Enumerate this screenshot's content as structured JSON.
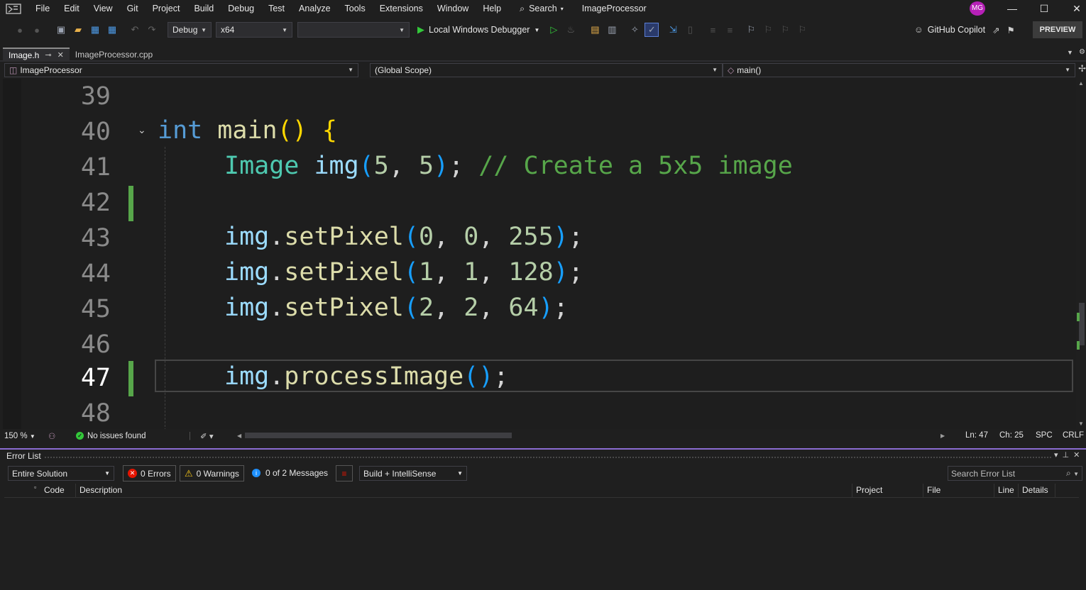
{
  "menu": {
    "items": [
      "File",
      "Edit",
      "View",
      "Git",
      "Project",
      "Build",
      "Debug",
      "Test",
      "Analyze",
      "Tools",
      "Extensions",
      "Window",
      "Help"
    ],
    "search_label": "Search",
    "solution_name": "ImageProcessor",
    "avatar_initials": "MG"
  },
  "toolbar": {
    "configuration": "Debug",
    "platform": "x64",
    "startup_item": "",
    "run_label": "Local Windows Debugger",
    "copilot_label": "GitHub Copilot",
    "preview_label": "PREVIEW"
  },
  "tabs": [
    {
      "label": "Image.h",
      "active": true
    },
    {
      "label": "ImageProcessor.cpp",
      "active": false
    }
  ],
  "navbar": {
    "project": "ImageProcessor",
    "scope": "(Global Scope)",
    "member": "main()"
  },
  "editor": {
    "lines": [
      {
        "number": "39"
      },
      {
        "number": "40"
      },
      {
        "number": "41"
      },
      {
        "number": "42"
      },
      {
        "number": "43"
      },
      {
        "number": "44"
      },
      {
        "number": "45"
      },
      {
        "number": "46"
      },
      {
        "number": "47"
      },
      {
        "number": "48"
      }
    ],
    "code": {
      "l40_kw": "int",
      "l40_fn": "main",
      "l41_type": "Image",
      "l41_var": "img",
      "l41_a1": "5",
      "l41_a2": "5",
      "l41_comment": "// Create a 5x5 image",
      "l43_var": "img",
      "l43_fn": "setPixel",
      "l43_args": [
        "0",
        "0",
        "255"
      ],
      "l44_var": "img",
      "l44_fn": "setPixel",
      "l44_args": [
        "1",
        "1",
        "128"
      ],
      "l45_var": "img",
      "l45_fn": "setPixel",
      "l45_args": [
        "2",
        "2",
        "64"
      ],
      "l47_var": "img",
      "l47_fn": "processImage"
    },
    "current_line": 47
  },
  "status": {
    "zoom": "150 %",
    "issues": "No issues found",
    "line": "Ln: 47",
    "column": "Ch: 25",
    "whitespace": "SPC",
    "line_ending": "CRLF"
  },
  "error_list": {
    "title": "Error List",
    "scope": "Entire Solution",
    "errors": "0 Errors",
    "warnings": "0 Warnings",
    "messages": "0 of 2 Messages",
    "build_filter": "Build + IntelliSense",
    "search_placeholder": "Search Error List",
    "columns": [
      "Code",
      "Description",
      "Project",
      "File",
      "Line",
      "Details"
    ]
  },
  "colors": {
    "accent_purple": "#8a6bd1",
    "change_marker": "#57a64a",
    "keyword": "#569cd6",
    "function": "#dcdcaa",
    "type": "#4ec9b0",
    "comment": "#57a64a"
  }
}
